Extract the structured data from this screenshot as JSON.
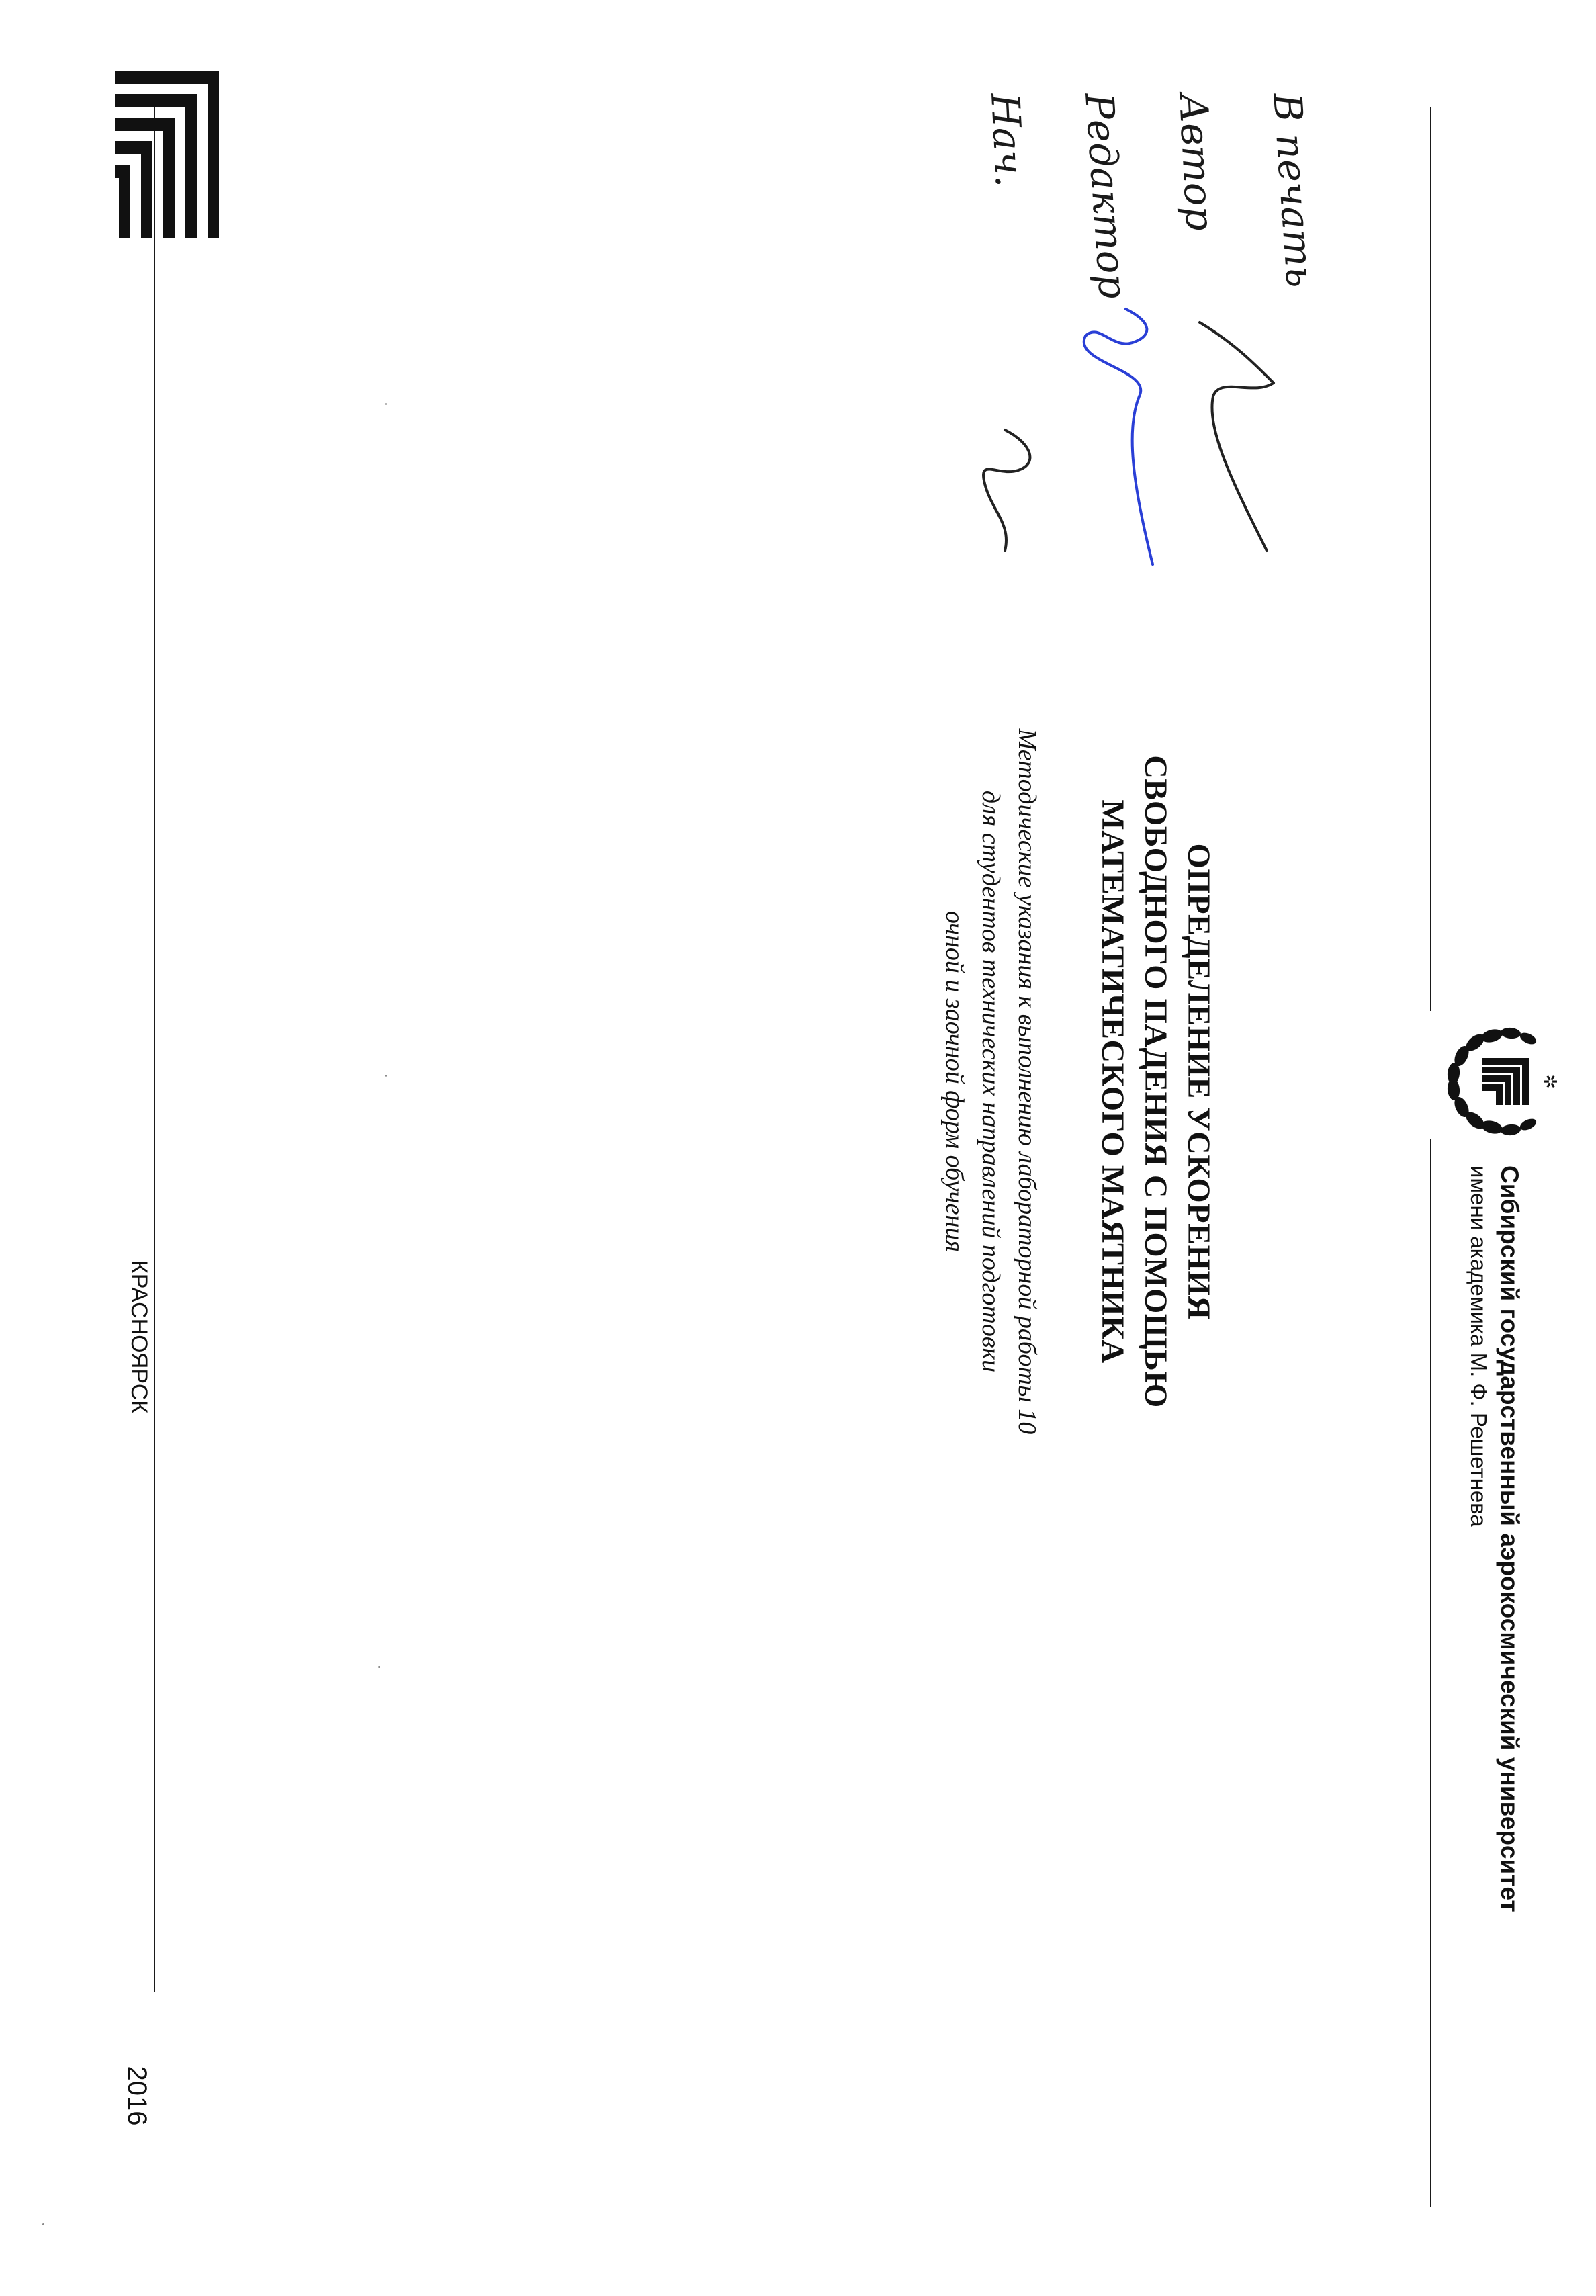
{
  "university": {
    "name": "Сибирский государственный аэрокосмический университет",
    "subtitle": "имени академика М. Ф. Решетнева"
  },
  "title": {
    "line1": "ОПРЕДЕЛЕНИЕ УСКОРЕНИЯ",
    "line2": "СВОБОДНОГО ПАДЕНИЯ С ПОМОЩЬЮ",
    "line3": "МАТЕМАТИЧЕСКОГО МАЯТНИКА"
  },
  "description": {
    "line1": "Методические указания к выполнению лабораторной работы 10",
    "line2": "для студентов технических направлений подготовки",
    "line3": "очной и заочной форм обучения"
  },
  "footer": {
    "city": "КРАСНОЯРСК",
    "year": "2016"
  },
  "handwritten": {
    "line1": "В печать",
    "line2": "Автор",
    "line3": "Редактор",
    "line4": "Нач."
  },
  "icons": {
    "top_logo": "university-emblem-icon",
    "bottom_logo": "university-logo-mark-icon"
  },
  "colors": {
    "ink": "#111111",
    "signature_blue": "#2a3fd6"
  }
}
